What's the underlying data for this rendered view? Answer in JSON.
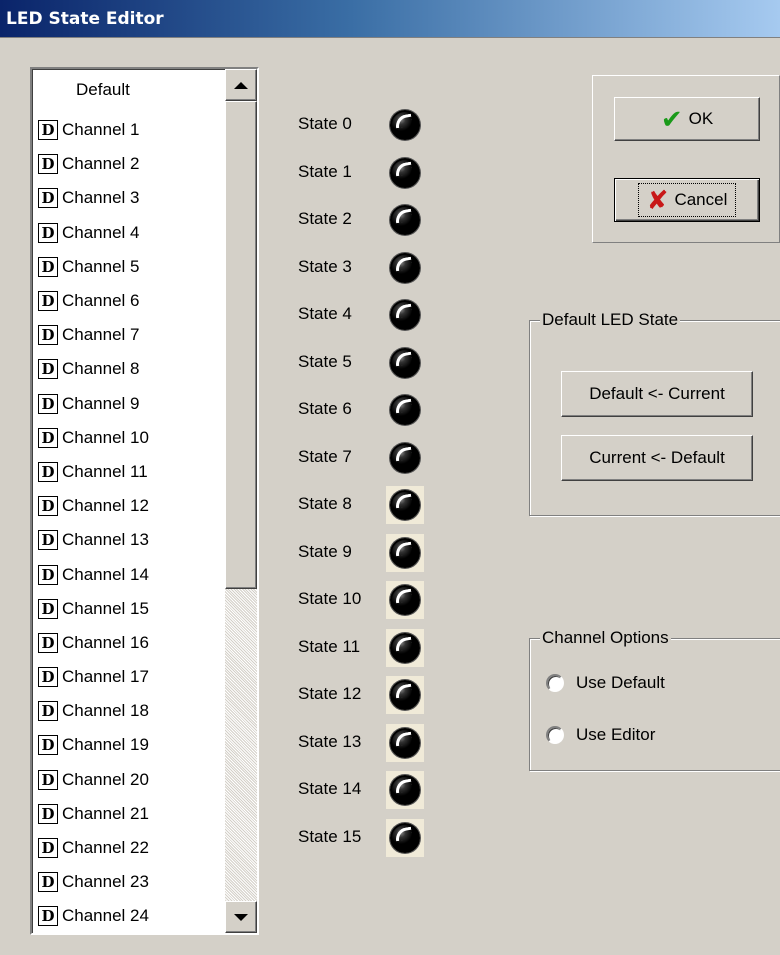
{
  "window": {
    "title": "LED State Editor"
  },
  "channel_list": {
    "header": "Default",
    "item_icon_letter": "D",
    "items": [
      "Channel  1",
      "Channel  2",
      "Channel  3",
      "Channel  4",
      "Channel  5",
      "Channel  6",
      "Channel  7",
      "Channel  8",
      "Channel  9",
      "Channel 10",
      "Channel 11",
      "Channel 12",
      "Channel 13",
      "Channel 14",
      "Channel 15",
      "Channel 16",
      "Channel 17",
      "Channel 18",
      "Channel 19",
      "Channel 20",
      "Channel 21",
      "Channel 22",
      "Channel 23",
      "Channel 24"
    ]
  },
  "states": [
    "State 0",
    "State 1",
    "State 2",
    "State 3",
    "State 4",
    "State 5",
    "State 6",
    "State 7",
    "State 8",
    "State 9",
    "State 10",
    "State 11",
    "State 12",
    "State 13",
    "State 14",
    "State 15"
  ],
  "buttons": {
    "ok": "OK",
    "cancel": "Cancel"
  },
  "default_led_state": {
    "title": "Default LED State",
    "default_from_current": "Default <- Current",
    "current_from_default": "Current <- Default"
  },
  "channel_options": {
    "title": "Channel Options",
    "use_default": "Use Default",
    "use_editor": "Use Editor"
  },
  "colors": {
    "ok_check": "#1a9a1a",
    "cancel_x": "#c81818",
    "titlebar_start": "#0a246a"
  }
}
